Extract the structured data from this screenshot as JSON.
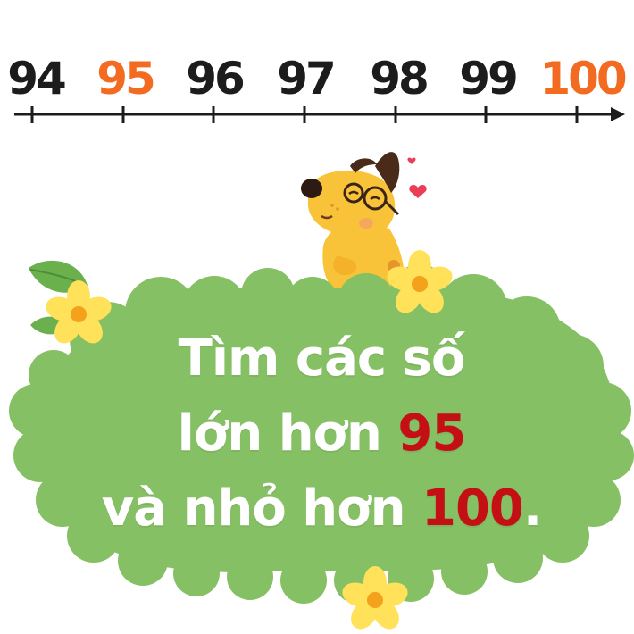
{
  "number_line": {
    "labels": [
      {
        "text": "94",
        "color": "#1c1c1c"
      },
      {
        "text": "95",
        "color": "#f26b21"
      },
      {
        "text": "96",
        "color": "#1c1c1c"
      },
      {
        "text": "97",
        "color": "#1c1c1c"
      },
      {
        "text": "98",
        "color": "#1c1c1c"
      },
      {
        "text": "99",
        "color": "#1c1c1c"
      },
      {
        "text": "100",
        "color": "#f26b21"
      }
    ]
  },
  "caption": {
    "line1": "Tìm các số",
    "line2_text": "lớn hơn",
    "line2_number": "95",
    "line3_text": "và nhỏ hơn",
    "line3_number": "100",
    "line3_end": "."
  },
  "colors": {
    "cloud_green": "#86c064",
    "highlight_red": "#c40f14",
    "accent_orange": "#f26b21",
    "dog_yellow": "#f8c338",
    "flower_yellow": "#ffe25a"
  },
  "icons": [
    "dog-illustration",
    "flower-icon",
    "leaf-icon",
    "heart-icon"
  ]
}
